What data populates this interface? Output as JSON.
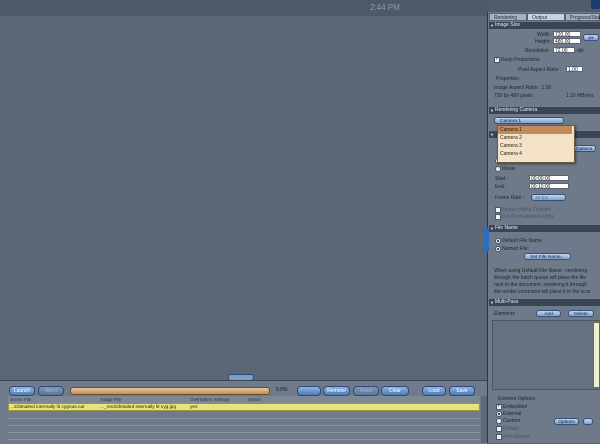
{
  "clock": "2:44 PM",
  "queue": {
    "buttons": {
      "launch": "Launch",
      "abort": "Abort",
      "remove": "Remove",
      "reset": "Reset",
      "clear": "Clear",
      "load": "Load",
      "save": "Save"
    },
    "progress": 0,
    "progress_label": "0.0%",
    "columns": [
      "Scene File",
      "Image File",
      "Overridden Settings",
      "Status"
    ],
    "rows": [
      {
        "scene_file": "...2/detailed internally lit cygnus.car",
        "image_file": "..._rev2/detailed internally lit cyg.jpg",
        "overridden": "yes",
        "status": ""
      }
    ]
  },
  "panel": {
    "tabs": [
      "Rendering",
      "Output",
      "Progress/Stat"
    ],
    "active_tab": "Output",
    "image_size": {
      "title": "Image Size",
      "width_label": "Width :",
      "width": "720.00",
      "height_label": "Height :",
      "height": "480.00",
      "unit": "px",
      "resolution_label": "Resolution :",
      "resolution": "72.00",
      "res_unit": "dpi",
      "keep_proportions": "Keep Proportions",
      "pixel_aspect_label": "Pixel Aspect Ratio :",
      "pixel_aspect": "1.00",
      "properties_label": "Properties",
      "image_aspect": "Image Aspect Ratio :   1.50",
      "pixels": "720 by 480 pixels",
      "mbytes": "1.32 MBytes"
    },
    "rendering_camera": {
      "title": "Rendering Camera",
      "selected": "Camera 1",
      "options": [
        "Camera 1",
        "Camera 2",
        "Camera 3",
        "Camera 4"
      ]
    },
    "frames": {
      "options_button": "Options",
      "current_frame": "Current Frame",
      "movie": "Movie",
      "start_label": "Start :",
      "start": "00:00:00",
      "end_label": "End :",
      "end": "00:10:00",
      "frame_rate_label": "Frame Rate :",
      "frame_rate": "30 fps",
      "render_alpha": "Render Alpha Channel",
      "premultiplied": "Use Premultiplied Alpha"
    },
    "file_name": {
      "title": "File Name",
      "default": "Default File Name",
      "named": "Named File:",
      "set_button": "Set File Name...",
      "description": [
        "When using Default File Name : rendering",
        "through the batch queue will place the file",
        "next to the document, rendering it through",
        "the render command will place it in the scra"
      ]
    },
    "multipass": {
      "title": "Multi-Pass",
      "elements_label": "Elements",
      "add": "Add",
      "delete": "Delete",
      "element_options": "Element Options",
      "embedded": "Embedded",
      "external": "External",
      "custom": "Custom",
      "options_button": "Options",
      "default": "Default",
      "anti_aliased": "Anti-Aliased"
    }
  }
}
